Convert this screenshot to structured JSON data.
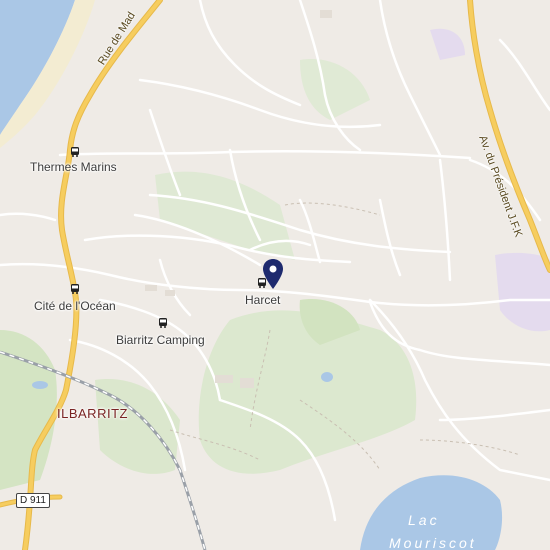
{
  "map": {
    "colors": {
      "land": "#efebe6",
      "water": "#aac7e6",
      "park": "#d7e6c8",
      "road_major": "#f6cd5f",
      "road_minor": "#ffffff",
      "rail": "#9aa0a8",
      "pin": "#1e2a6e",
      "place_label": "#7a2424"
    },
    "transit_stops": [
      {
        "name": "Thermes Marins",
        "icon": "bus-stop-icon"
      },
      {
        "name": "Harcet",
        "icon": "bus-stop-icon"
      },
      {
        "name": "Cité de l'Océan",
        "icon": "bus-stop-icon"
      },
      {
        "name": "Biarritz Camping",
        "icon": "bus-stop-icon"
      }
    ],
    "places": {
      "locality": "ILBARRITZ"
    },
    "roads": {
      "street_1": "Rue de Mad",
      "street_2": "Av. du Président J.F.K",
      "shield": "D 911"
    },
    "water": {
      "lake_line_1": "Lac",
      "lake_line_2": "Mouriscot"
    },
    "marker": {
      "icon": "location-pin-icon"
    }
  }
}
